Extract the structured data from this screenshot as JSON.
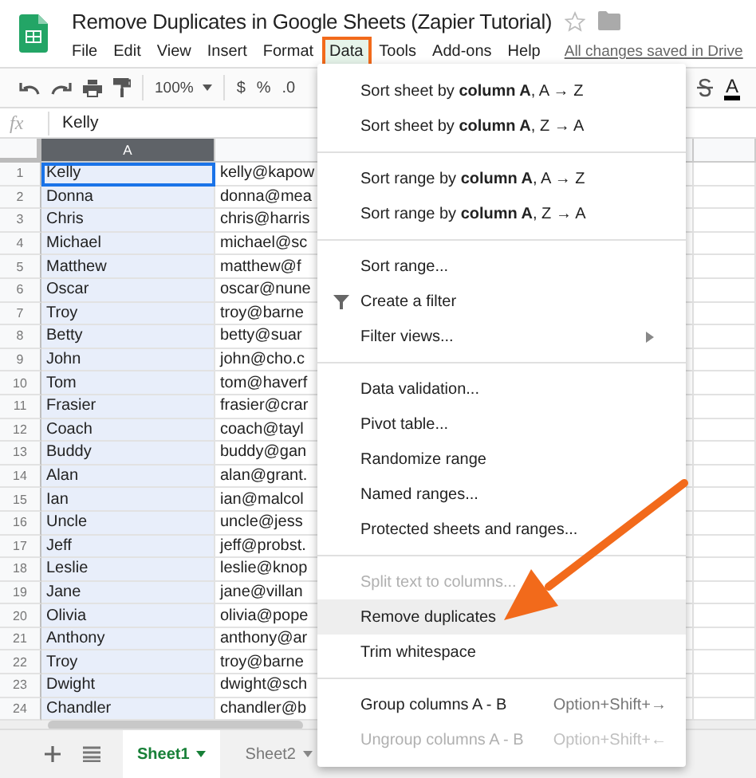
{
  "document": {
    "title": "Remove Duplicates in Google Sheets (Zapier Tutorial)"
  },
  "menu_bar": {
    "items": [
      {
        "label": "File",
        "selected": false
      },
      {
        "label": "Edit",
        "selected": false
      },
      {
        "label": "View",
        "selected": false
      },
      {
        "label": "Insert",
        "selected": false
      },
      {
        "label": "Format",
        "selected": false
      },
      {
        "label": "Data",
        "selected": true
      },
      {
        "label": "Tools",
        "selected": false
      },
      {
        "label": "Add-ons",
        "selected": false
      },
      {
        "label": "Help",
        "selected": false
      }
    ],
    "save_status": "All changes saved in Drive"
  },
  "toolbar": {
    "zoom": "100%",
    "currency": "$",
    "percent": "%",
    "decimal": ".0",
    "text_color": "A"
  },
  "formula_bar": {
    "label": "fx",
    "value": "Kelly"
  },
  "sheet": {
    "columns": [
      {
        "label": "A",
        "selected": true
      }
    ],
    "rows": [
      {
        "number": "1",
        "name": "Kelly",
        "email": "kelly@kapow",
        "active": true
      },
      {
        "number": "2",
        "name": "Donna",
        "email": "donna@mea",
        "active": false
      },
      {
        "number": "3",
        "name": "Chris",
        "email": "chris@harris",
        "active": false
      },
      {
        "number": "4",
        "name": "Michael",
        "email": "michael@sc",
        "active": false
      },
      {
        "number": "5",
        "name": "Matthew",
        "email": "matthew@f",
        "active": false
      },
      {
        "number": "6",
        "name": "Oscar",
        "email": "oscar@nune",
        "active": false
      },
      {
        "number": "7",
        "name": "Troy",
        "email": "troy@barne",
        "active": false
      },
      {
        "number": "8",
        "name": "Betty",
        "email": "betty@suar",
        "active": false
      },
      {
        "number": "9",
        "name": "John",
        "email": "john@cho.c",
        "active": false
      },
      {
        "number": "10",
        "name": "Tom",
        "email": "tom@haverf",
        "active": false
      },
      {
        "number": "11",
        "name": "Frasier",
        "email": "frasier@crar",
        "active": false
      },
      {
        "number": "12",
        "name": "Coach",
        "email": "coach@tayl",
        "active": false
      },
      {
        "number": "13",
        "name": "Buddy",
        "email": "buddy@gan",
        "active": false
      },
      {
        "number": "14",
        "name": "Alan",
        "email": "alan@grant.",
        "active": false
      },
      {
        "number": "15",
        "name": "Ian",
        "email": "ian@malcol",
        "active": false
      },
      {
        "number": "16",
        "name": "Uncle",
        "email": "uncle@jess",
        "active": false
      },
      {
        "number": "17",
        "name": "Jeff",
        "email": "jeff@probst.",
        "active": false
      },
      {
        "number": "18",
        "name": "Leslie",
        "email": "leslie@knop",
        "active": false
      },
      {
        "number": "19",
        "name": "Jane",
        "email": "jane@villan",
        "active": false
      },
      {
        "number": "20",
        "name": "Olivia",
        "email": "olivia@pope",
        "active": false
      },
      {
        "number": "21",
        "name": "Anthony",
        "email": "anthony@ar",
        "active": false
      },
      {
        "number": "22",
        "name": "Troy",
        "email": "troy@barne",
        "active": false
      },
      {
        "number": "23",
        "name": "Dwight",
        "email": "dwight@sch",
        "active": false
      },
      {
        "number": "24",
        "name": "Chandler",
        "email": "chandler@b",
        "active": false
      }
    ]
  },
  "sheet_tabs": [
    {
      "label": "Sheet1",
      "selected": true
    },
    {
      "label": "Sheet2",
      "selected": false
    }
  ],
  "data_menu": {
    "groups": [
      [
        {
          "label": "Sort sheet by **column A**, A → Z",
          "kind": "plain",
          "disabled": false,
          "highlighted": false
        },
        {
          "label": "Sort sheet by **column A**, Z → A",
          "kind": "plain",
          "disabled": false,
          "highlighted": false
        }
      ],
      [
        {
          "label": "Sort range by **column A**, A → Z",
          "kind": "plain",
          "disabled": false,
          "highlighted": false
        },
        {
          "label": "Sort range by **column A**, Z → A",
          "kind": "plain",
          "disabled": false,
          "highlighted": false
        }
      ],
      [
        {
          "label": "Sort range...",
          "kind": "plain",
          "disabled": false,
          "highlighted": false
        },
        {
          "label": "Create a filter",
          "kind": "filter",
          "disabled": false,
          "highlighted": false
        },
        {
          "label": "Filter views...",
          "kind": "submenu",
          "disabled": false,
          "highlighted": false
        }
      ],
      [
        {
          "label": "Data validation...",
          "kind": "plain",
          "disabled": false,
          "highlighted": false
        },
        {
          "label": "Pivot table...",
          "kind": "plain",
          "disabled": false,
          "highlighted": false
        },
        {
          "label": "Randomize range",
          "kind": "plain",
          "disabled": false,
          "highlighted": false
        },
        {
          "label": "Named ranges...",
          "kind": "plain",
          "disabled": false,
          "highlighted": false
        },
        {
          "label": "Protected sheets and ranges...",
          "kind": "plain",
          "disabled": false,
          "highlighted": false
        }
      ],
      [
        {
          "label": "Split text to columns...",
          "kind": "plain",
          "disabled": true,
          "highlighted": false
        },
        {
          "label": "Remove duplicates",
          "kind": "plain",
          "disabled": false,
          "highlighted": true
        },
        {
          "label": "Trim whitespace",
          "kind": "plain",
          "disabled": false,
          "highlighted": false
        }
      ],
      [
        {
          "label": "Group columns A - B",
          "kind": "shortcut",
          "shortcut": "Option+Shift+→",
          "disabled": false,
          "highlighted": false
        },
        {
          "label": "Ungroup columns A - B",
          "kind": "shortcut",
          "shortcut": "Option+Shift+←",
          "disabled": true,
          "highlighted": false
        }
      ]
    ]
  }
}
